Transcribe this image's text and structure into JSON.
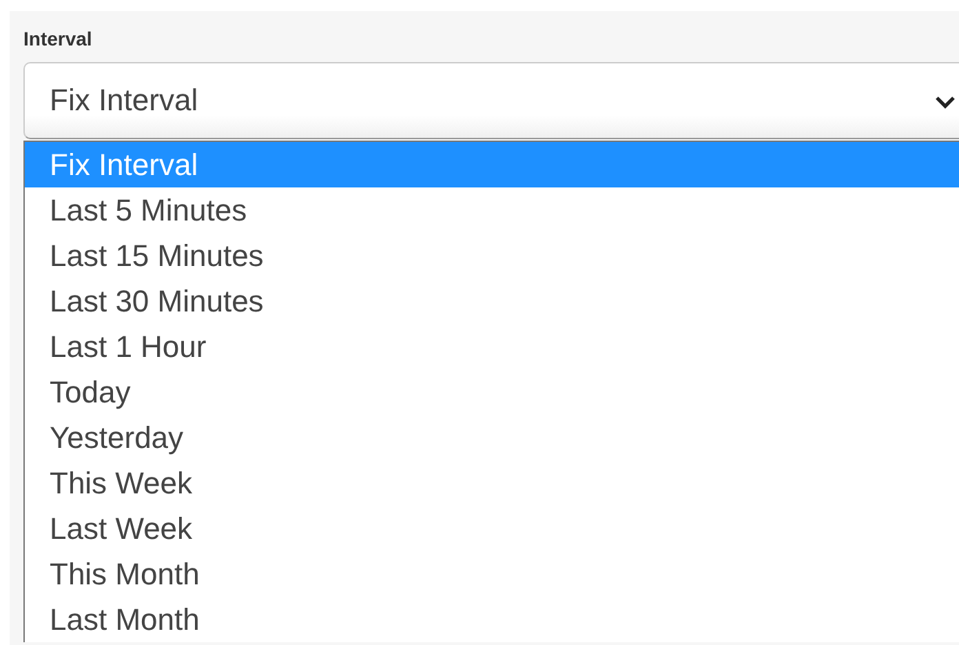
{
  "field": {
    "label": "Interval",
    "value": "Fix Interval",
    "expanded": true
  },
  "options": [
    {
      "label": "Fix Interval",
      "selected": true
    },
    {
      "label": "Last 5 Minutes",
      "selected": false
    },
    {
      "label": "Last 15 Minutes",
      "selected": false
    },
    {
      "label": "Last 30 Minutes",
      "selected": false
    },
    {
      "label": "Last 1 Hour",
      "selected": false
    },
    {
      "label": "Today",
      "selected": false
    },
    {
      "label": "Yesterday",
      "selected": false
    },
    {
      "label": "This Week",
      "selected": false
    },
    {
      "label": "Last Week",
      "selected": false
    },
    {
      "label": "This Month",
      "selected": false
    },
    {
      "label": "Last Month",
      "selected": false
    }
  ]
}
